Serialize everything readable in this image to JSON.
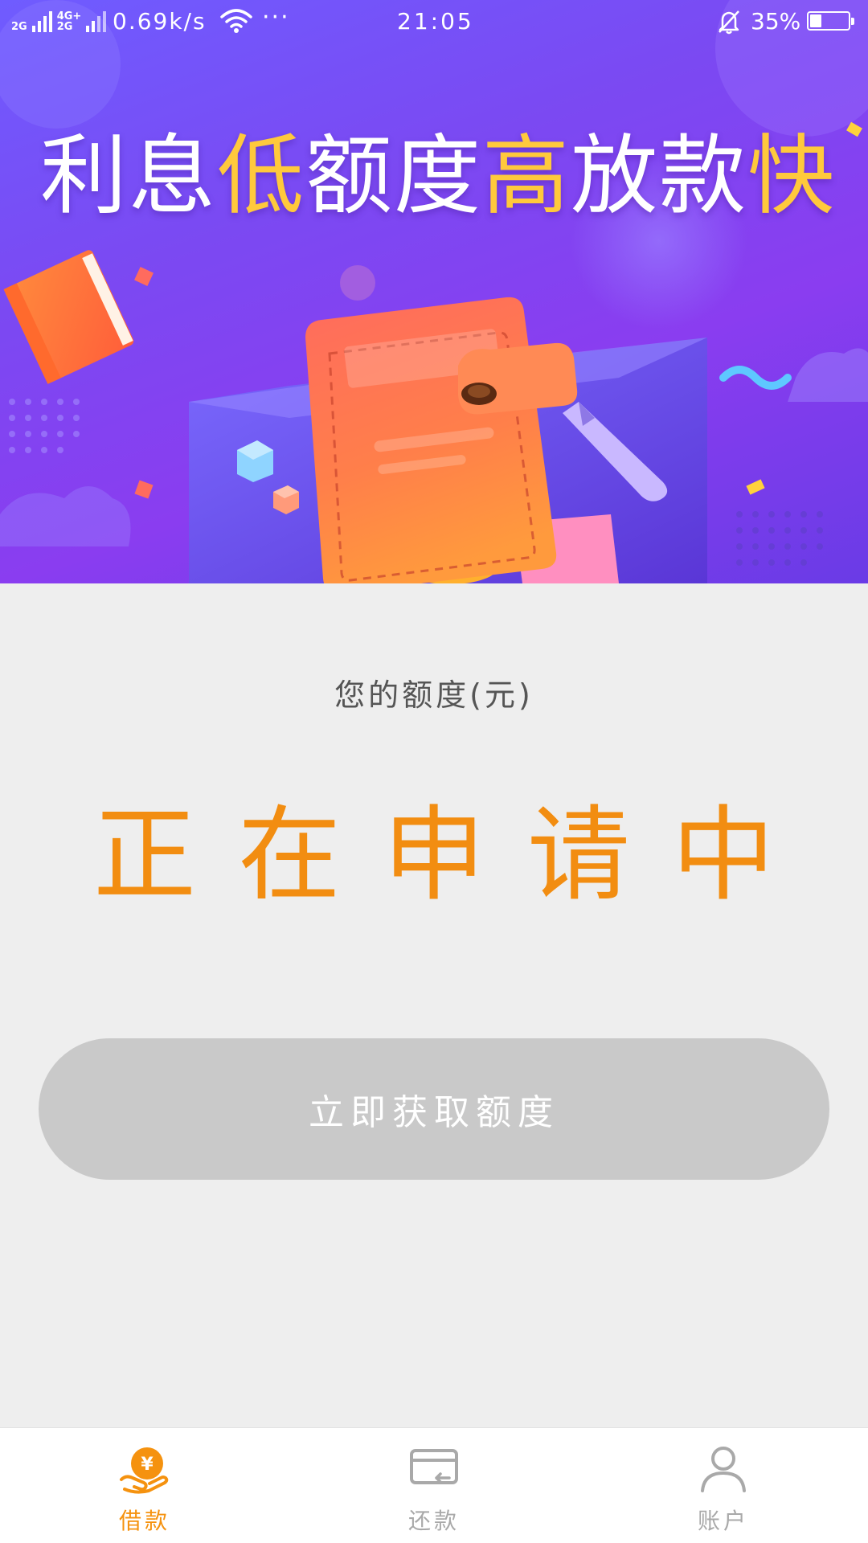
{
  "status_bar": {
    "network_1": "2G",
    "network_2a": "4G+",
    "network_2b": "2G",
    "speed": "0.69k/s",
    "more": "···",
    "time": "21:05",
    "battery_text": "35%",
    "battery_level": 0.35
  },
  "banner": {
    "headline": {
      "part1": "利息",
      "part2": "低",
      "part3": "额度",
      "part4": "高",
      "part5": "放款",
      "part6": "快"
    },
    "colors": {
      "white_text": "#ffffff",
      "highlight_text": "#ffc93c",
      "background_start": "#6f5cff",
      "background_end": "#6a3be6"
    }
  },
  "main": {
    "quota_label": "您的额度(元)",
    "status_text": "正在申请中",
    "cta_label": "立即获取额度",
    "status_color": "#f28d11",
    "cta_color": "#c9c9c9"
  },
  "tabbar": {
    "active_color": "#f5920f",
    "inactive_color": "#a9a9a9",
    "tabs": [
      {
        "label": "借款",
        "icon": "loan-yuan-hand-icon",
        "active": true
      },
      {
        "label": "还款",
        "icon": "card-repay-icon",
        "active": false
      },
      {
        "label": "账户",
        "icon": "user-icon",
        "active": false
      }
    ]
  }
}
